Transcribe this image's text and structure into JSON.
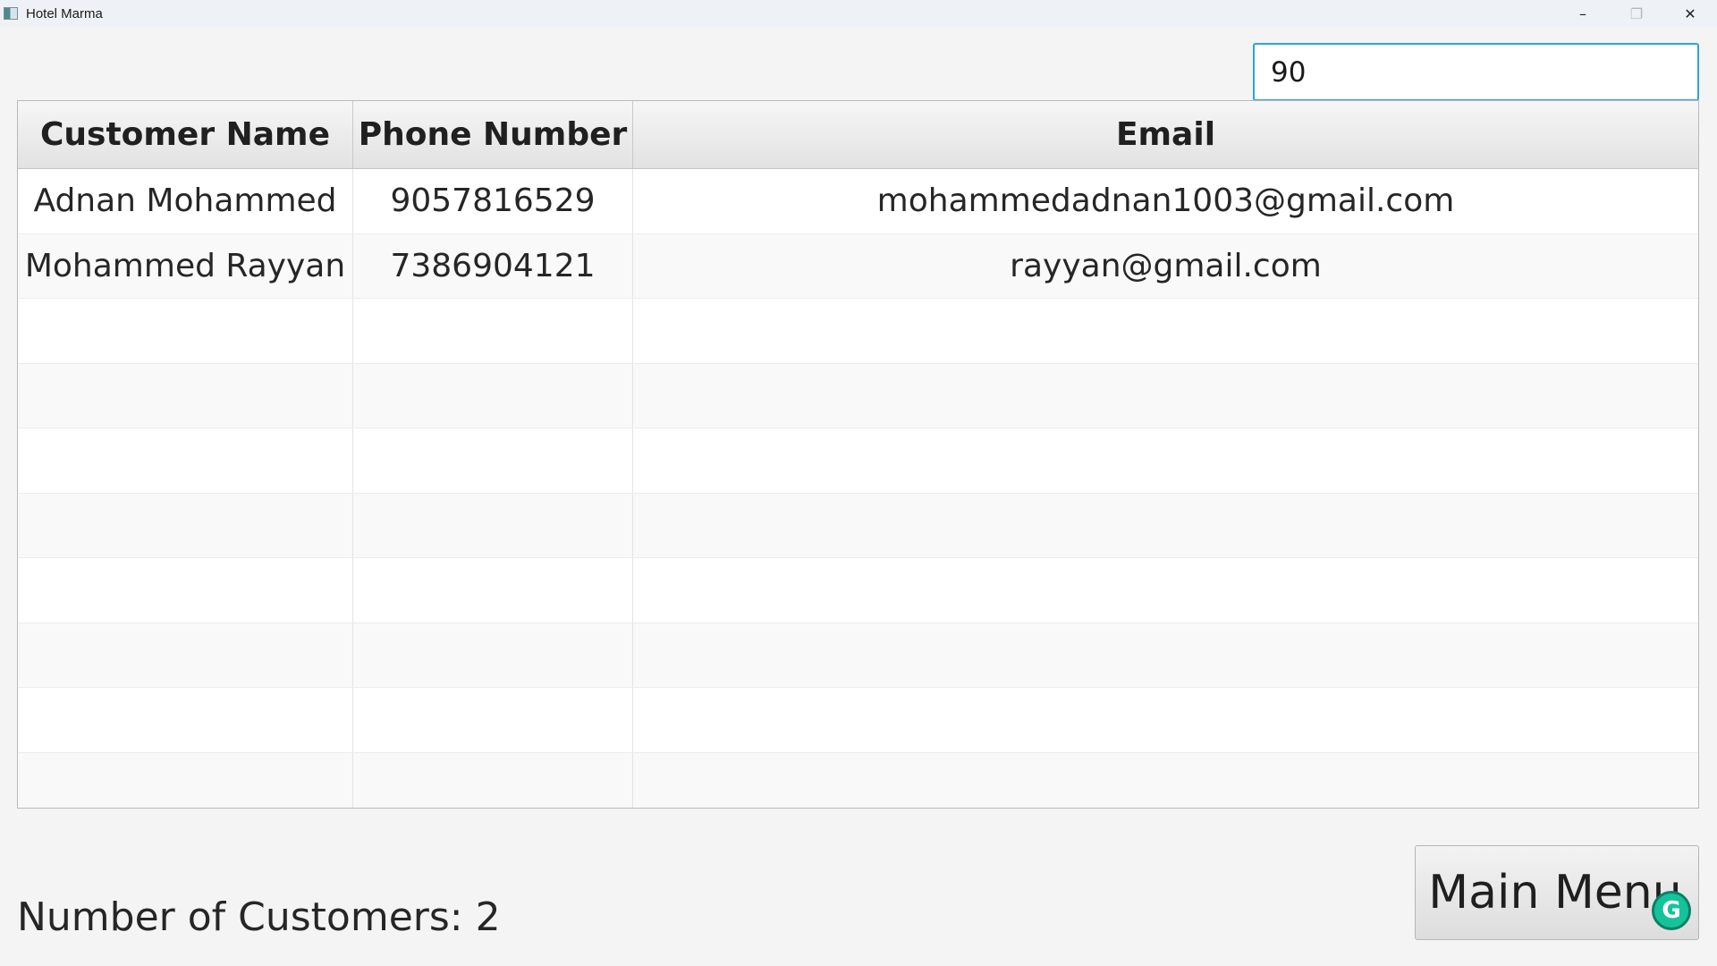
{
  "window": {
    "title": "Hotel Marma",
    "minimize_glyph": "–",
    "maximize_glyph": "❐",
    "close_glyph": "✕"
  },
  "search": {
    "value": "90"
  },
  "table": {
    "columns": [
      "Customer Name",
      "Phone Number",
      "Email"
    ],
    "rows": [
      [
        "Adnan Mohammed",
        "9057816529",
        "mohammedadnan1003@gmail.com"
      ],
      [
        "Mohammed Rayyan",
        "7386904121",
        "rayyan@gmail.com"
      ],
      [
        "",
        "",
        ""
      ],
      [
        "",
        "",
        ""
      ],
      [
        "",
        "",
        ""
      ],
      [
        "",
        "",
        ""
      ],
      [
        "",
        "",
        ""
      ],
      [
        "",
        "",
        ""
      ],
      [
        "",
        "",
        ""
      ],
      [
        "",
        "",
        ""
      ]
    ]
  },
  "footer": {
    "count_text": "Number of Customers: 2",
    "main_menu_label": "Main Menu"
  },
  "overlay": {
    "grammarly_glyph": "G"
  },
  "colors": {
    "accent": "#2ea3d8",
    "grammarly": "#15c39a"
  }
}
